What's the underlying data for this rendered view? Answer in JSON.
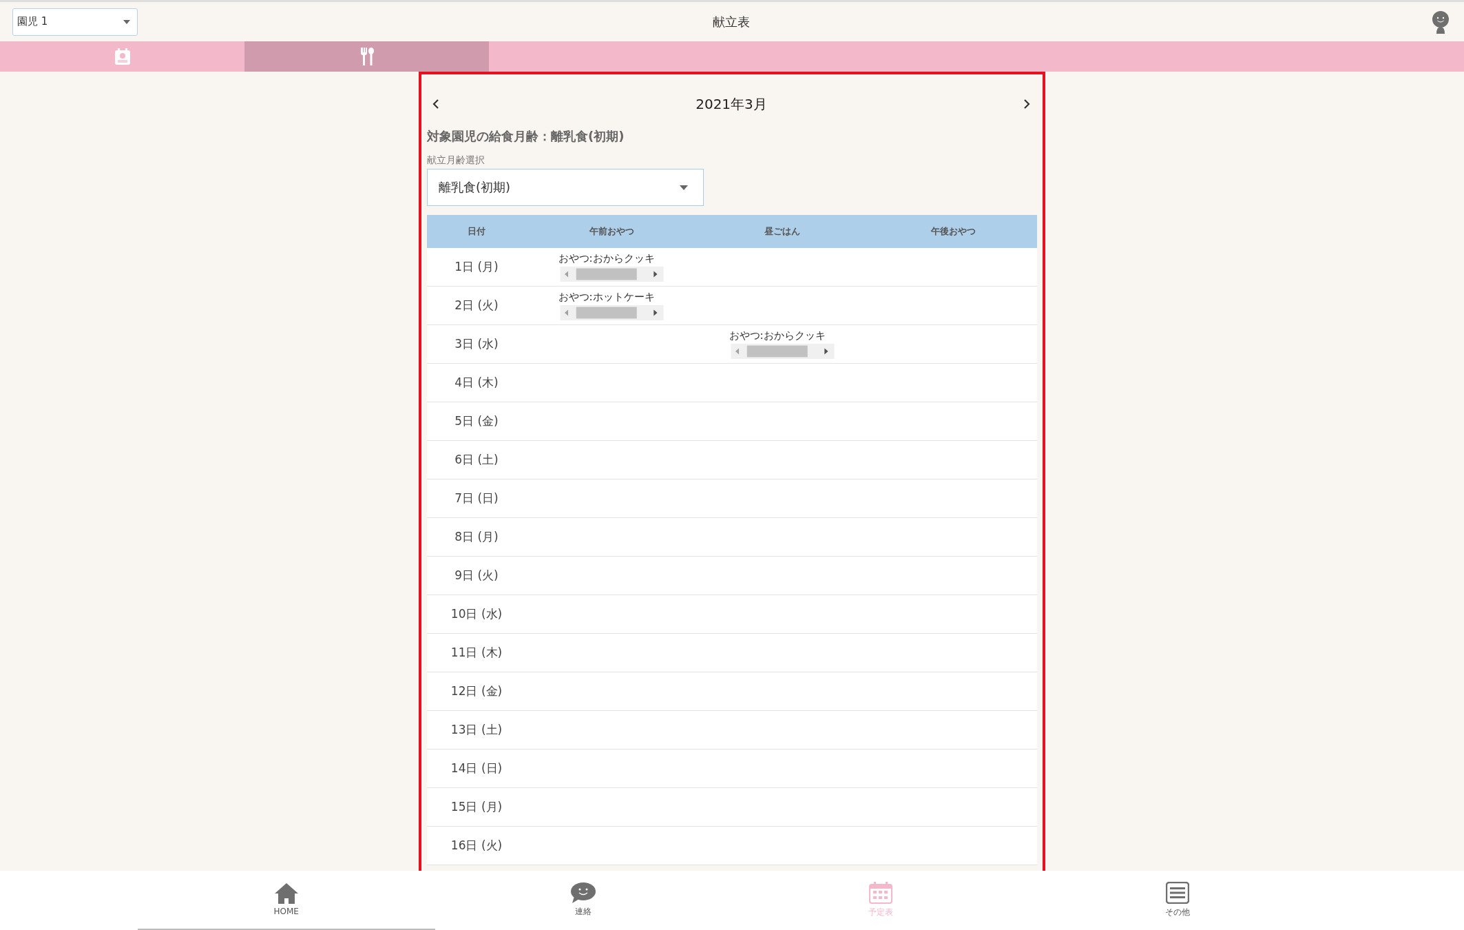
{
  "child_select": {
    "value": "園児 1"
  },
  "title": "献立表",
  "tabs": [
    {
      "kind": "calendar",
      "selected": false
    },
    {
      "kind": "cutlery",
      "selected": true
    }
  ],
  "month": {
    "label": "2021年3月"
  },
  "info": "対象園児の給食月齢：離乳食(初期)",
  "age_select": {
    "label": "献立月齢選択",
    "value": "離乳食(初期)"
  },
  "table": {
    "columns": [
      "日付",
      "午前おやつ",
      "昼ごはん",
      "午後おやつ"
    ],
    "rows": [
      {
        "date": "1日 (月)",
        "morning": "おやつ:おからクッキ",
        "lunch": "",
        "afternoon": ""
      },
      {
        "date": "2日 (火)",
        "morning": "おやつ:ホットケーキ",
        "lunch": "",
        "afternoon": ""
      },
      {
        "date": "3日 (水)",
        "morning": "",
        "lunch": "おやつ:おからクッキ",
        "afternoon": ""
      },
      {
        "date": "4日 (木)",
        "morning": "",
        "lunch": "",
        "afternoon": ""
      },
      {
        "date": "5日 (金)",
        "morning": "",
        "lunch": "",
        "afternoon": ""
      },
      {
        "date": "6日 (土)",
        "morning": "",
        "lunch": "",
        "afternoon": ""
      },
      {
        "date": "7日 (日)",
        "morning": "",
        "lunch": "",
        "afternoon": ""
      },
      {
        "date": "8日 (月)",
        "morning": "",
        "lunch": "",
        "afternoon": ""
      },
      {
        "date": "9日 (火)",
        "morning": "",
        "lunch": "",
        "afternoon": ""
      },
      {
        "date": "10日 (水)",
        "morning": "",
        "lunch": "",
        "afternoon": ""
      },
      {
        "date": "11日 (木)",
        "morning": "",
        "lunch": "",
        "afternoon": ""
      },
      {
        "date": "12日 (金)",
        "morning": "",
        "lunch": "",
        "afternoon": ""
      },
      {
        "date": "13日 (土)",
        "morning": "",
        "lunch": "",
        "afternoon": ""
      },
      {
        "date": "14日 (日)",
        "morning": "",
        "lunch": "",
        "afternoon": ""
      },
      {
        "date": "15日 (月)",
        "morning": "",
        "lunch": "",
        "afternoon": ""
      },
      {
        "date": "16日 (火)",
        "morning": "",
        "lunch": "",
        "afternoon": ""
      }
    ]
  },
  "bottom_nav": [
    {
      "kind": "home",
      "label": "HOME",
      "selected": true,
      "active": false
    },
    {
      "kind": "chat",
      "label": "連絡",
      "selected": false,
      "active": false
    },
    {
      "kind": "calendar",
      "label": "予定表",
      "selected": false,
      "active": true
    },
    {
      "kind": "menu",
      "label": "その他",
      "selected": false,
      "active": false
    }
  ]
}
